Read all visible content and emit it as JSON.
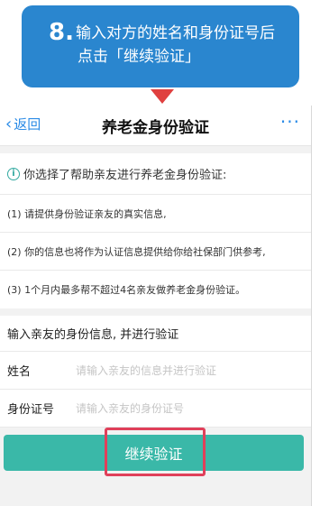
{
  "callout": {
    "step": "8.",
    "line1": "输入对方的姓名和身份证号后",
    "line2": "点击「继续验证」"
  },
  "navbar": {
    "back_label": "返回",
    "title": "养老金身份验证",
    "more": "···"
  },
  "notice": {
    "text": "你选择了帮助亲友进行养老金身份验证:"
  },
  "items": [
    "(1) 请提供身份验证亲友的真实信息,",
    "(2) 你的信息也将作为认证信息提供给你给社保部门供参考,",
    "(3) 1个月内最多帮不超过4名亲友做养老金身份验证。"
  ],
  "form": {
    "section_title": "输入亲友的身份信息, 并进行验证",
    "name_label": "姓名",
    "name_placeholder": "请输入亲友的信息并进行验证",
    "id_label": "身份证号",
    "id_placeholder": "请输入亲友的身份证号"
  },
  "continue_button": "继续验证",
  "colors": {
    "callout_bg": "#2a86cf",
    "accent_blue": "#2b8be6",
    "button_teal": "#3ab8a8",
    "highlight_red": "#e0405a"
  }
}
